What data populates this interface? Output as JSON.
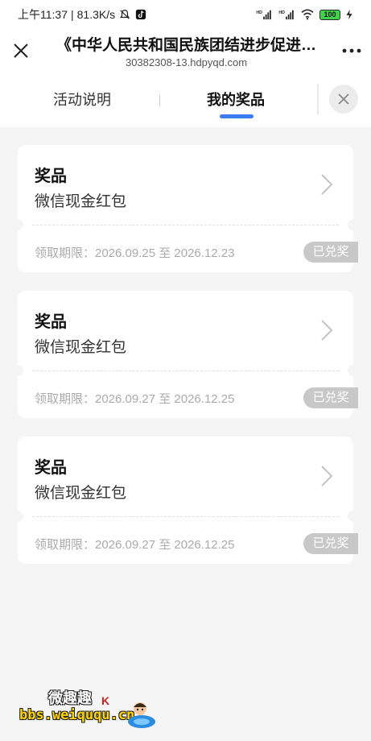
{
  "status_bar": {
    "time": "上午11:37",
    "separator": "|",
    "speed": "81.3K/s",
    "battery": "100",
    "icons": [
      "bell-muted-icon",
      "tiktok-icon",
      "hd-signal-icon",
      "hd-signal-icon",
      "wifi-icon",
      "battery-icon",
      "charging-icon"
    ]
  },
  "title_bar": {
    "title": "《中华人民共和国民族团结进步促进…",
    "url": "30382308-13.hdpyqd.com"
  },
  "tabs": [
    {
      "label": "活动说明"
    },
    {
      "label": "我的奖品"
    }
  ],
  "prizes": [
    {
      "title": "奖品",
      "name": "微信现金红包",
      "period": "领取期限：2026.09.25 至 2026.12.23",
      "status": "已兑奖"
    },
    {
      "title": "奖品",
      "name": "微信现金红包",
      "period": "领取期限：2026.09.27 至 2026.12.25",
      "status": "已兑奖"
    },
    {
      "title": "奖品",
      "name": "微信现金红包",
      "period": "领取期限：2026.09.27 至 2026.12.25",
      "status": "已兑奖"
    }
  ],
  "watermark": {
    "top": "微趣趣",
    "bottom": "bbs.weiququ.cn",
    "mark": "K"
  },
  "colors": {
    "accent": "#3b7cf0",
    "badge": "#c8c8c8",
    "page_bg": "#f5f5f5"
  }
}
